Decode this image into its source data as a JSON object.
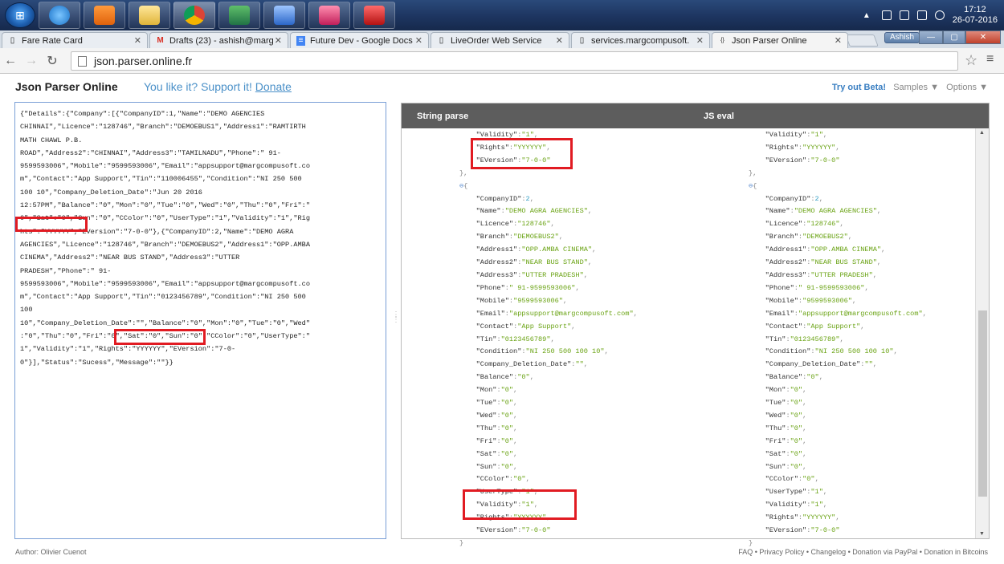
{
  "tabs": [
    {
      "label": "Fare Rate Card"
    },
    {
      "label": "Drafts (23) - ashish@marg"
    },
    {
      "label": "Future Dev - Google Docs"
    },
    {
      "label": "LiveOrder Web Service"
    },
    {
      "label": "services.margcompusoft."
    },
    {
      "label": "Json Parser Online"
    }
  ],
  "user_badge": "Ashish",
  "clock": {
    "time": "17:12",
    "date": "26-07-2016"
  },
  "url": "json.parser.online.fr",
  "header": {
    "title": "Json Parser Online",
    "like_text": "You like it? Support it!",
    "donate": "Donate",
    "try_beta": "Try out Beta!",
    "samples": "Samples ▼",
    "options": "Options ▼"
  },
  "viewer": {
    "string_parse": "String parse",
    "js_eval": "JS eval"
  },
  "input_text": "{\"Details\":{\"Company\":[{\"CompanyID\":1,\"Name\":\"DEMO AGENCIES\nCHINNAI\",\"Licence\":\"128746\",\"Branch\":\"DEMOEBUS1\",\"Address1\":\"RAMTIRTH\nMATH CHAWL P.B.\nROAD\",\"Address2\":\"CHINNAI\",\"Address3\":\"TAMILNADU\",\"Phone\":\" 91-\n9599593006\",\"Mobile\":\"9599593006\",\"Email\":\"appsupport@margcompusoft.co\nm\",\"Contact\":\"App Support\",\"Tin\":\"110006455\",\"Condition\":\"NI 250 500\n100 10\",\"Company_Deletion_Date\":\"Jun 20 2016\n12:57PM\",\"Balance\":\"0\",\"Mon\":\"0\",\"Tue\":\"0\",\"Wed\":\"0\",\"Thu\":\"0\",\"Fri\":\"\n0\",\"Sat\":\"0\",\"Sun\":\"0\",\"CColor\":\"0\",\"UserType\":\"1\",\"Validity\":\"1\",\"Rig\nhts\":\"YYYYYY\",\"EVersion\":\"7-0-0\"},{\"CompanyID\":2,\"Name\":\"DEMO AGRA\nAGENCIES\",\"Licence\":\"128746\",\"Branch\":\"DEMOEBUS2\",\"Address1\":\"OPP.AMBA\nCINEMA\",\"Address2\":\"NEAR BUS STAND\",\"Address3\":\"UTTER\nPRADESH\",\"Phone\":\" 91-\n9599593006\",\"Mobile\":\"9599593006\",\"Email\":\"appsupport@margcompusoft.co\nm\",\"Contact\":\"App Support\",\"Tin\":\"0123456789\",\"Condition\":\"NI 250 500\n100\n10\",\"Company_Deletion_Date\":\"\",\"Balance\":\"0\",\"Mon\":\"0\",\"Tue\":\"0\",\"Wed\"\n:\"0\",\"Thu\":\"0\",\"Fri\":\"0\",\"Sat\":\"0\",\"Sun\":\"0\",\"CColor\":\"0\",\"UserType\":\"\n1\",\"Validity\":\"1\",\"Rights\":\"YYYYYY\",\"EVersion\":\"7-0-\n0\"}],\"Status\":\"Sucess\",\"Message\":\"\"}}",
  "tree_top": [
    [
      "Validity",
      "\"1\""
    ],
    [
      "Rights",
      "\"YYYYYY\""
    ],
    [
      "EVersion",
      "\"7-0-0\""
    ]
  ],
  "tree_company2": [
    [
      "CompanyID",
      "2"
    ],
    [
      "Name",
      "\"DEMO AGRA AGENCIES\""
    ],
    [
      "Licence",
      "\"128746\""
    ],
    [
      "Branch",
      "\"DEMOEBUS2\""
    ],
    [
      "Address1",
      "\"OPP.AMBA CINEMA\""
    ],
    [
      "Address2",
      "\"NEAR BUS STAND\""
    ],
    [
      "Address3",
      "\"UTTER PRADESH\""
    ],
    [
      "Phone",
      "\" 91-9599593006\""
    ],
    [
      "Mobile",
      "\"9599593006\""
    ],
    [
      "Email",
      "\"appsupport@margcompusoft.com\""
    ],
    [
      "Contact",
      "\"App Support\""
    ],
    [
      "Tin",
      "\"0123456789\""
    ],
    [
      "Condition",
      "\"NI 250 500 100 10\""
    ],
    [
      "Company_Deletion_Date",
      "\"\""
    ],
    [
      "Balance",
      "\"0\""
    ],
    [
      "Mon",
      "\"0\""
    ],
    [
      "Tue",
      "\"0\""
    ],
    [
      "Wed",
      "\"0\""
    ],
    [
      "Thu",
      "\"0\""
    ],
    [
      "Fri",
      "\"0\""
    ],
    [
      "Sat",
      "\"0\""
    ],
    [
      "Sun",
      "\"0\""
    ],
    [
      "CColor",
      "\"0\""
    ],
    [
      "UserType",
      "\"1\""
    ],
    [
      "Validity",
      "\"1\""
    ],
    [
      "Rights",
      "\"YYYYYY\""
    ],
    [
      "EVersion",
      "\"7-0-0\""
    ]
  ],
  "footer": {
    "author": "Author: Olivier Cuenot",
    "links": "FAQ • Privacy Policy • Changelog • Donation via PayPal • Donation in Bitcoins"
  }
}
